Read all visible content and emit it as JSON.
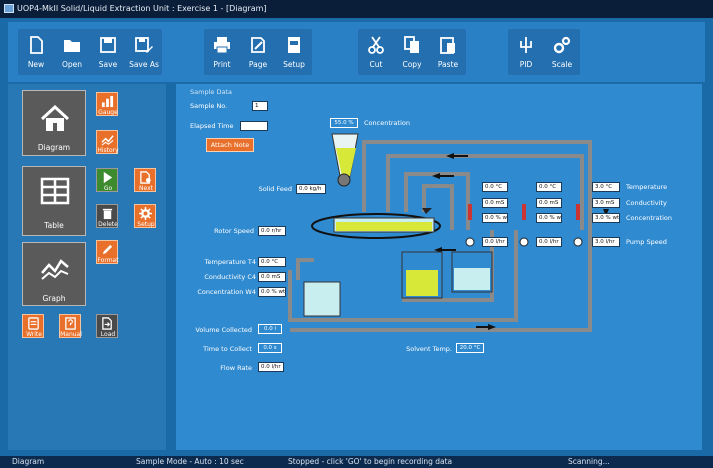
{
  "window": {
    "title": "UOP4-MkII Solid/Liquid Extraction Unit : Exercise 1 - [Diagram]"
  },
  "toolbar": {
    "new": "New",
    "open": "Open",
    "save": "Save",
    "save_as": "Save As",
    "print": "Print",
    "page": "Page",
    "setup": "Setup",
    "cut": "Cut",
    "copy": "Copy",
    "paste": "Paste",
    "pid": "PID",
    "scale": "Scale"
  },
  "sidebar": {
    "diagram": "Diagram",
    "table": "Table",
    "graph": "Graph",
    "gauge": "Gauge",
    "history": "History",
    "go": "Go",
    "next": "Next",
    "delete": "Delete",
    "setup": "Setup",
    "format": "Format",
    "write": "Write",
    "manual": "Manual",
    "load": "Load"
  },
  "panel": {
    "heading": "Sample Data",
    "sample_no_label": "Sample No.",
    "sample_no": "1",
    "elapsed_time_label": "Elapsed Time",
    "elapsed_time": "",
    "attach_note": "Attach Note"
  },
  "process": {
    "concentration_label": "Concentration",
    "concentration_value": "55.0 %",
    "solid_feed_label": "Solid Feed",
    "solid_feed_value": "0.0 kg/h",
    "rotor_speed_label": "Rotor Speed",
    "rotor_speed_value": "0.0 r/hr",
    "temperature_t4_label": "Temperature T4",
    "temperature_t4_value": "0.0 °C",
    "conductivity_c4_label": "Conductivity C4",
    "conductivity_c4_value": "0.0 mS",
    "concentration_w4_label": "Concentration W4",
    "concentration_w4_value": "0.0 % wt",
    "row_temperature_label": "Temperature",
    "row_conductivity_label": "Conductivity",
    "row_concentration_label": "Concentration",
    "row_pump_speed_label": "Pump Speed",
    "stages": [
      {
        "temperature": "0.0 °C",
        "conductivity": "0.0 mS",
        "concentration": "0.0 % wt",
        "pump_speed": "0.0 l/hr"
      },
      {
        "temperature": "0.0 °C",
        "conductivity": "0.0 mS",
        "concentration": "0.0 % wt",
        "pump_speed": "0.0 l/hr"
      },
      {
        "temperature": "3.0 °C",
        "conductivity": "3.0 mS",
        "concentration": "3.0 % wt",
        "pump_speed": "3.0 l/hr"
      }
    ],
    "volume_collected_label": "Volume Collected",
    "volume_collected_value": "0.0 l",
    "time_to_collect_label": "Time to Collect",
    "time_to_collect_value": "0.0 s",
    "flow_rate_label": "Flow Rate",
    "flow_rate_value": "0.0 l/hr",
    "solvent_temp_label": "Solvent Temp.",
    "solvent_temp_value": "20.0 °C"
  },
  "status": {
    "view": "Diagram",
    "sample_mode": "Sample Mode - Auto : 10 sec",
    "message": "Stopped - click 'GO' to begin recording data",
    "scan": "Scanning..."
  },
  "colors": {
    "accent_orange": "#e8702a",
    "panel_blue": "#2f8ad0",
    "pipe_grey": "#8a8a8a",
    "liquid": "#c8eef0",
    "solids": "#d8e838"
  }
}
